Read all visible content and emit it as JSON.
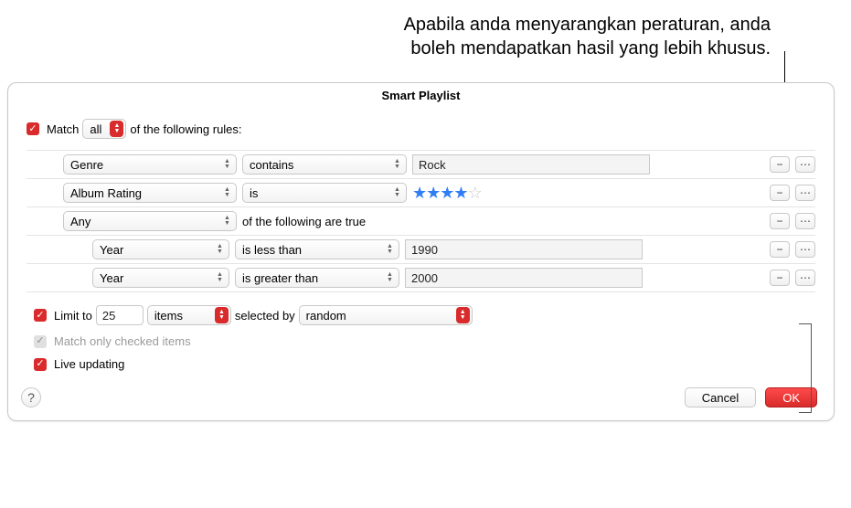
{
  "annotation": {
    "line1": "Apabila anda menyarangkan peraturan, anda",
    "line2": "boleh mendapatkan hasil yang lebih khusus."
  },
  "dialog": {
    "title": "Smart Playlist",
    "match": {
      "prefix": "Match",
      "mode": "all",
      "suffix": "of the following rules:"
    },
    "rules": [
      {
        "field": "Genre",
        "op": "contains",
        "value": "Rock",
        "indent": 0,
        "valueType": "text"
      },
      {
        "field": "Album Rating",
        "op": "is",
        "value_stars": 4,
        "value_max": 5,
        "indent": 0,
        "valueType": "stars"
      },
      {
        "field": "Any",
        "suffix_text": "of the following are true",
        "indent": 0,
        "valueType": "group"
      },
      {
        "field": "Year",
        "op": "is less than",
        "value": "1990",
        "indent": 1,
        "valueType": "text"
      },
      {
        "field": "Year",
        "op": "is greater than",
        "value": "2000",
        "indent": 1,
        "valueType": "text"
      }
    ],
    "limit": {
      "label": "Limit to",
      "count": "25",
      "unit": "items",
      "selected_by_label": "selected by",
      "selected_by": "random"
    },
    "match_checked": {
      "label": "Match only checked items"
    },
    "live": {
      "label": "Live updating"
    },
    "buttons": {
      "cancel": "Cancel",
      "ok": "OK",
      "help": "?"
    }
  }
}
